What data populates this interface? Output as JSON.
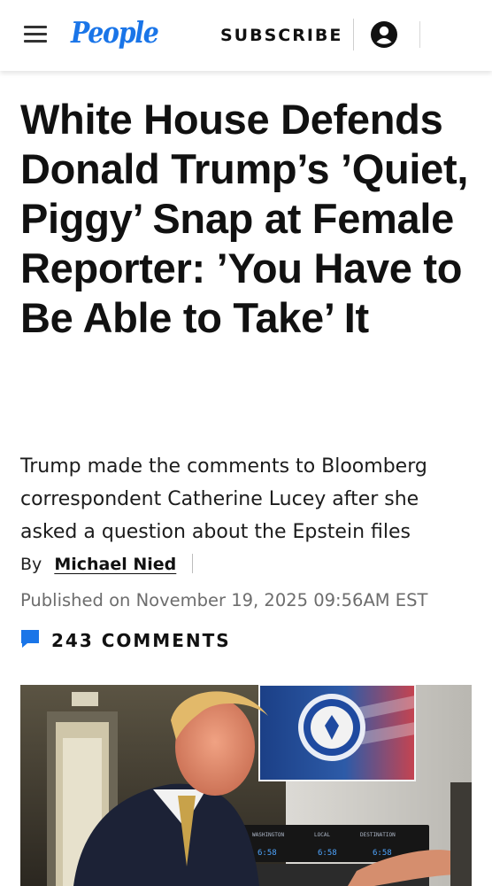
{
  "header": {
    "menu_icon": "hamburger-menu-icon",
    "logo_text": "People",
    "subscribe_label": "SUBSCRIBE",
    "account_icon": "account-icon",
    "brand_color": "#1a75e8"
  },
  "article": {
    "headline": "White House Defends Donald Trump’s ’Quiet, Piggy’ Snap at Female Reporter: ’You Have to Be Able to Take’ It",
    "dek": "Trump made the comments to Bloomberg correspondent Catherine Lucey after she asked a question about the Epstein files",
    "byline_prefix": "By",
    "author": "Michael Nied",
    "published": "Published on November 19, 2025 09:56AM EST",
    "comments_icon": "comment-bubble-icon",
    "comments_label": "243 COMMENTS",
    "comments_color": "#1a75e8"
  },
  "hero_image": {
    "panel_labels": [
      "WASHINGTON",
      "LOCAL",
      "DESTINATION"
    ],
    "panel_readouts": [
      "6:58",
      "6:58",
      "6:58"
    ]
  }
}
